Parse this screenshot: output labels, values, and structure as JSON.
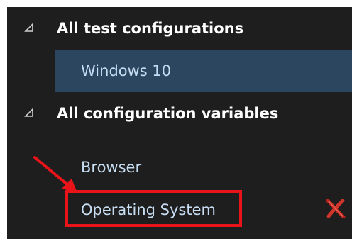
{
  "tree": {
    "test_configurations": {
      "header": "All test configurations",
      "items": [
        "Windows 10"
      ]
    },
    "configuration_variables": {
      "header": "All configuration variables",
      "items": [
        "Browser",
        "Operating System"
      ]
    }
  },
  "icons": {
    "expander": "expanded-triangle-icon",
    "remove": "delete-x-icon",
    "annotation": "red-arrow-annotation"
  },
  "colors": {
    "background": "#1e1e1e",
    "selected_row": "#2c4660",
    "item_text": "#c7ddf2",
    "header_text": "#ffffff",
    "annotation": "#e8141a"
  }
}
